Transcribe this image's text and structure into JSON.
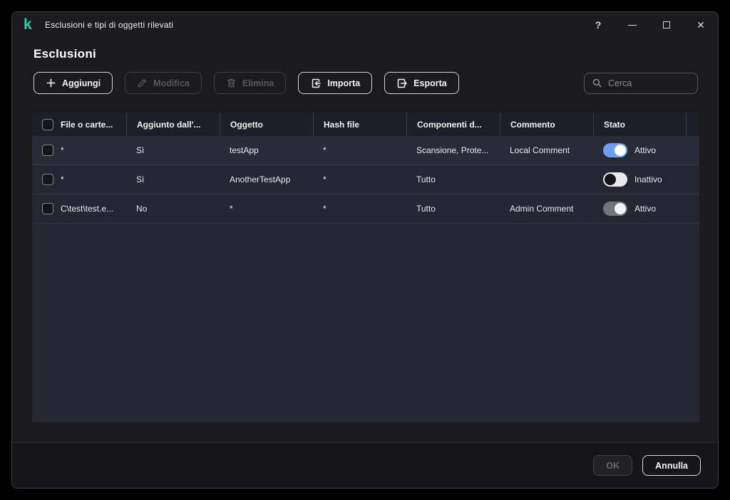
{
  "window": {
    "title": "Esclusioni e tipi di oggetti rilevati",
    "controls": {
      "help": "?",
      "minimize": "minimize",
      "maximize": "maximize",
      "close": "✕"
    }
  },
  "page": {
    "title": "Esclusioni"
  },
  "toolbar": {
    "buttons": [
      {
        "id": "add",
        "label": "Aggiungi",
        "icon": "plus-icon",
        "enabled": true
      },
      {
        "id": "edit",
        "label": "Modifica",
        "icon": "pencil-icon",
        "enabled": false
      },
      {
        "id": "delete",
        "label": "Elimina",
        "icon": "trash-icon",
        "enabled": false
      },
      {
        "id": "import",
        "label": "Importa",
        "icon": "import-icon",
        "enabled": true
      },
      {
        "id": "export",
        "label": "Esporta",
        "icon": "export-icon",
        "enabled": true
      }
    ],
    "search": {
      "placeholder": "Cerca",
      "value": ""
    }
  },
  "table": {
    "columns": [
      "File o carte...",
      "Aggiunto dall'...",
      "Oggetto",
      "Hash file",
      "Componenti d...",
      "Commento",
      "Stato"
    ],
    "rows": [
      {
        "file": "*",
        "added_by": "Sì",
        "object": "testApp",
        "hash": "*",
        "components": "Scansione, Prote...",
        "comment": "Local Comment",
        "status": "Attivo",
        "toggle": "on",
        "highlighted": true
      },
      {
        "file": "*",
        "added_by": "Sì",
        "object": "AnotherTestApp",
        "hash": "*",
        "components": "Tutto",
        "comment": "",
        "status": "Inattivo",
        "toggle": "off",
        "highlighted": false
      },
      {
        "file": "C\\test\\test.e...",
        "added_by": "No",
        "object": "*",
        "hash": "*",
        "components": "Tutto",
        "comment": "Admin Comment",
        "status": "Attivo",
        "toggle": "on_disabled",
        "highlighted": false
      }
    ]
  },
  "footer": {
    "ok": "OK",
    "cancel": "Annulla"
  },
  "colors": {
    "accent_teal": "#26CFA7",
    "toggle_on_blue": "#6F9DF3",
    "window_bg": "#1B1B1D",
    "table_row_bg": "#252632",
    "table_header_bg": "#1D1E27"
  }
}
